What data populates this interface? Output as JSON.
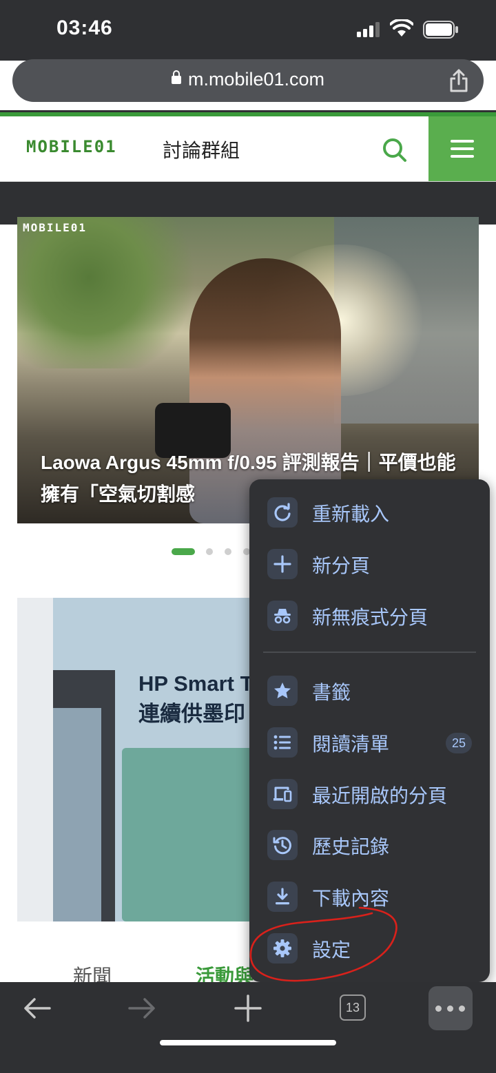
{
  "status_bar": {
    "time": "03:46"
  },
  "address_bar": {
    "url": "m.mobile01.com"
  },
  "site_header": {
    "logo_text": "MOBILE01",
    "section": "討論群組"
  },
  "hero": {
    "logo_text": "MOBILE01",
    "title": "Laowa Argus 45mm f/0.95 評測報告｜平價也能擁有「空氣切割感"
  },
  "carousel": {
    "total": 5,
    "active": 1
  },
  "ad": {
    "text_line1": "HP Smart T",
    "text_line2": "連續供墨印"
  },
  "page_tabs": [
    "新聞",
    "活動與"
  ],
  "menu": {
    "items": [
      {
        "label": "重新載入",
        "icon": "reload-icon"
      },
      {
        "label": "新分頁",
        "icon": "plus-icon"
      },
      {
        "label": "新無痕式分頁",
        "icon": "incognito-icon"
      },
      {
        "label": "書籤",
        "icon": "star-icon"
      },
      {
        "label": "閱讀清單",
        "icon": "list-icon",
        "badge": "25"
      },
      {
        "label": "最近開啟的分頁",
        "icon": "devices-icon"
      },
      {
        "label": "歷史記錄",
        "icon": "history-icon"
      },
      {
        "label": "下載內容",
        "icon": "download-icon"
      },
      {
        "label": "設定",
        "icon": "gear-icon"
      }
    ]
  },
  "toolbar": {
    "tab_count": "13"
  },
  "colors": {
    "chrome_dark": "#2f3033",
    "menu_bg": "#303134",
    "menu_text": "#a8c7fa",
    "site_green": "#5aae4e",
    "annotation_red": "#d9211b"
  }
}
